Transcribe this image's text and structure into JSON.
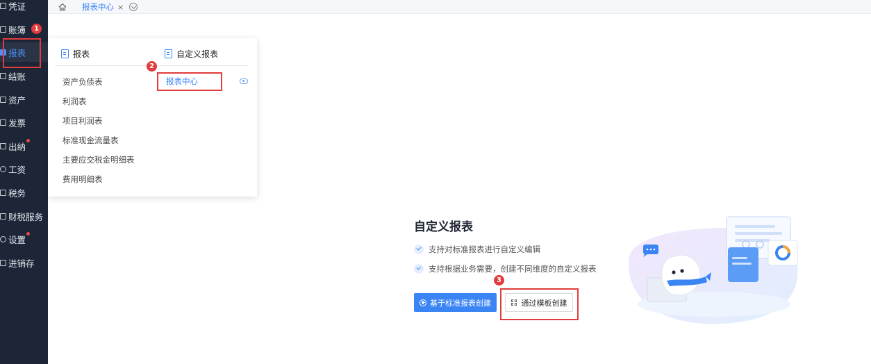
{
  "sidebar": {
    "items": [
      {
        "label": "凭证"
      },
      {
        "label": "账簿"
      },
      {
        "label": "报表"
      },
      {
        "label": "结账"
      },
      {
        "label": "资产"
      },
      {
        "label": "发票"
      },
      {
        "label": "出纳"
      },
      {
        "label": "工资"
      },
      {
        "label": "税务"
      },
      {
        "label": "财税服务"
      },
      {
        "label": "设置"
      },
      {
        "label": "进销存"
      }
    ],
    "active": "报表"
  },
  "tabs": {
    "active_label": "报表中心",
    "close_label": "×"
  },
  "dropdown": {
    "col1_header": "报表",
    "col2_header": "自定义报表",
    "col1_items": [
      "资产负债表",
      "利润表",
      "项目利润表",
      "标准现金流量表",
      "主要应交税金明细表",
      "费用明细表"
    ],
    "col2_items": [
      "报表中心"
    ]
  },
  "annotations": {
    "step1": "1",
    "step2": "2",
    "step3": "3"
  },
  "main": {
    "title": "自定义报表",
    "features": [
      "支持对标准报表进行自定义编辑",
      "支持根据业务需要，创建不同维度的自定义报表"
    ],
    "primary_button": "基于标准报表创建",
    "secondary_button": "通过模板创建"
  },
  "colors": {
    "sidebar_bg": "#1d2637",
    "accent": "#3a84f3",
    "annotation_red": "#e23b3b"
  }
}
